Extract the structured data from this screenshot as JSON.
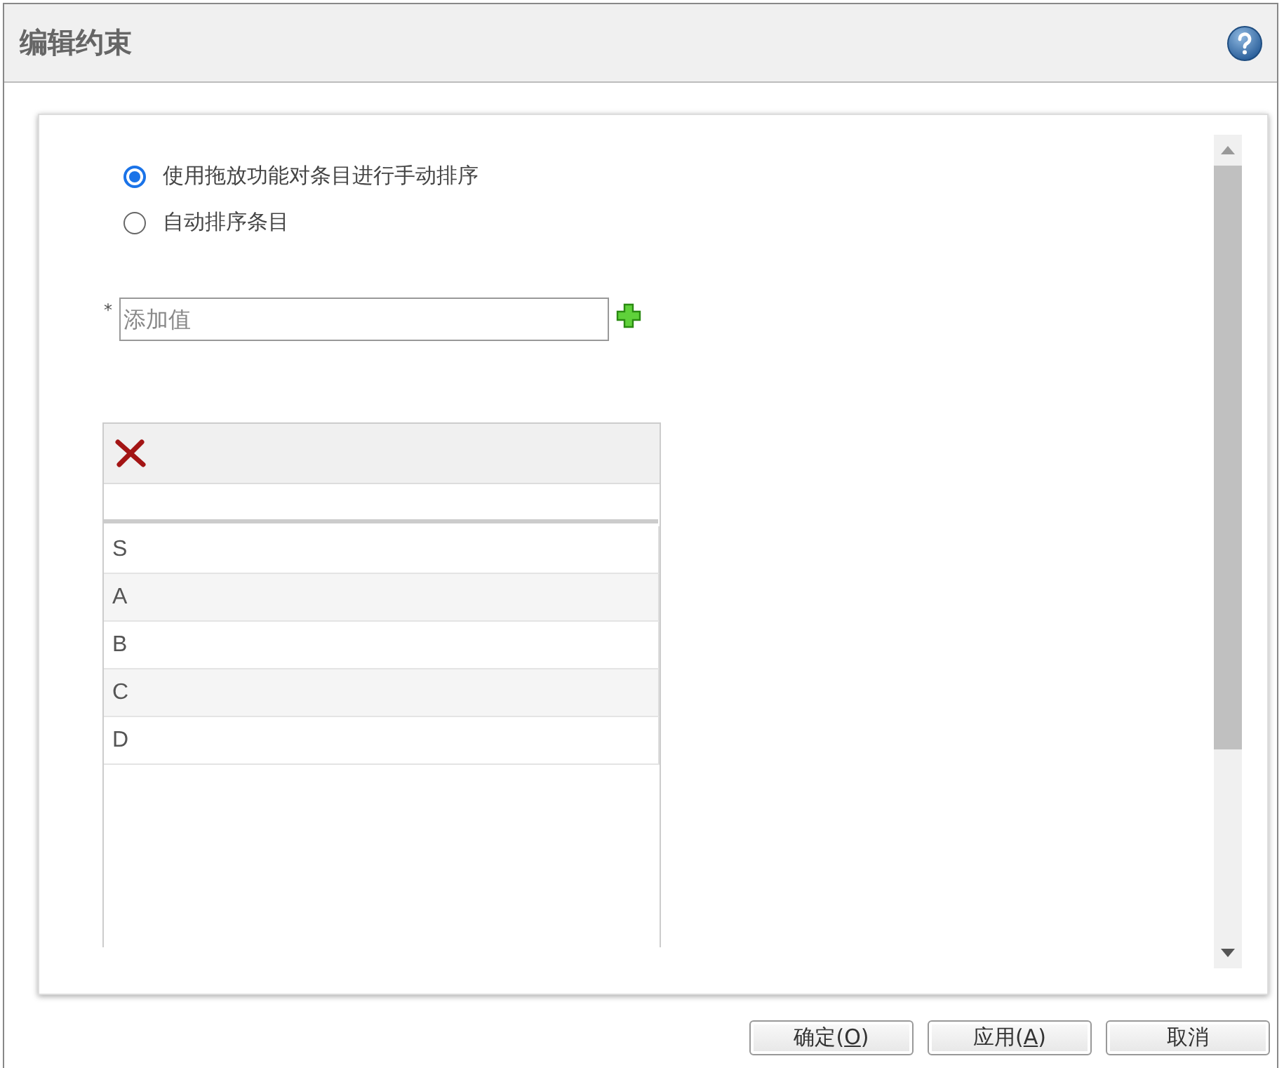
{
  "window": {
    "title": "编辑约束"
  },
  "sort_options": [
    {
      "label": "使用拖放功能对条目进行手动排序",
      "selected": true
    },
    {
      "label": "自动排序条目",
      "selected": false
    }
  ],
  "add_value": {
    "required_mark": "*",
    "placeholder": "添加值"
  },
  "value_list": {
    "items": [
      "S",
      "A",
      "B",
      "C",
      "D"
    ]
  },
  "buttons": [
    {
      "label_before": "确定(",
      "access_key": "O",
      "label_after": ")"
    },
    {
      "label_before": "应用(",
      "access_key": "A",
      "label_after": ")"
    },
    {
      "label_before": "取消"
    }
  ]
}
